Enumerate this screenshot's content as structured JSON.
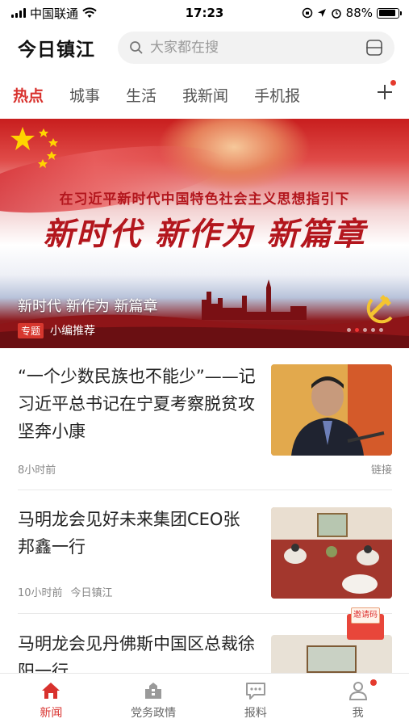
{
  "status_bar": {
    "carrier": "中国联通",
    "time": "17:23",
    "battery": "88%",
    "battery_level": 0.88
  },
  "header": {
    "title": "今日镇江",
    "search_placeholder": "大家都在搜",
    "icons": [
      "search-icon",
      "scan-icon"
    ]
  },
  "tabs": [
    {
      "label": "热点",
      "active": true
    },
    {
      "label": "城事"
    },
    {
      "label": "生活"
    },
    {
      "label": "我新闻"
    },
    {
      "label": "手机报"
    }
  ],
  "banner": {
    "subtitle": "在习近平新时代中国特色社会主义思想指引下",
    "headline": "新时代 新作为 新篇章",
    "caption": "新时代 新作为 新篇章",
    "badge": "专题",
    "recommend": "小编推荐",
    "slides": 5,
    "current_slide": 2
  },
  "news": [
    {
      "title": "“一个少数民族也不能少”——记习近平总书记在宁夏考察脱贫攻坚奔小康",
      "time": "8小时前",
      "source": "",
      "tag": "链接"
    },
    {
      "title": "马明龙会见好未来集团CEO张邦鑫一行",
      "time": "10小时前",
      "source": "今日镇江",
      "tag": ""
    },
    {
      "title": "马明龙会见丹佛斯中国区总裁徐阳一行",
      "time": "",
      "source": "",
      "tag": ""
    }
  ],
  "invite_label": "邀请码",
  "bottom_nav": [
    {
      "label": "新闻",
      "icon": "home-icon",
      "active": true
    },
    {
      "label": "党务政情",
      "icon": "building-icon"
    },
    {
      "label": "报料",
      "icon": "chat-icon"
    },
    {
      "label": "我",
      "icon": "user-icon",
      "badge": true
    }
  ],
  "colors": {
    "accent": "#d8312d",
    "text": "#222222",
    "muted": "#888888"
  }
}
